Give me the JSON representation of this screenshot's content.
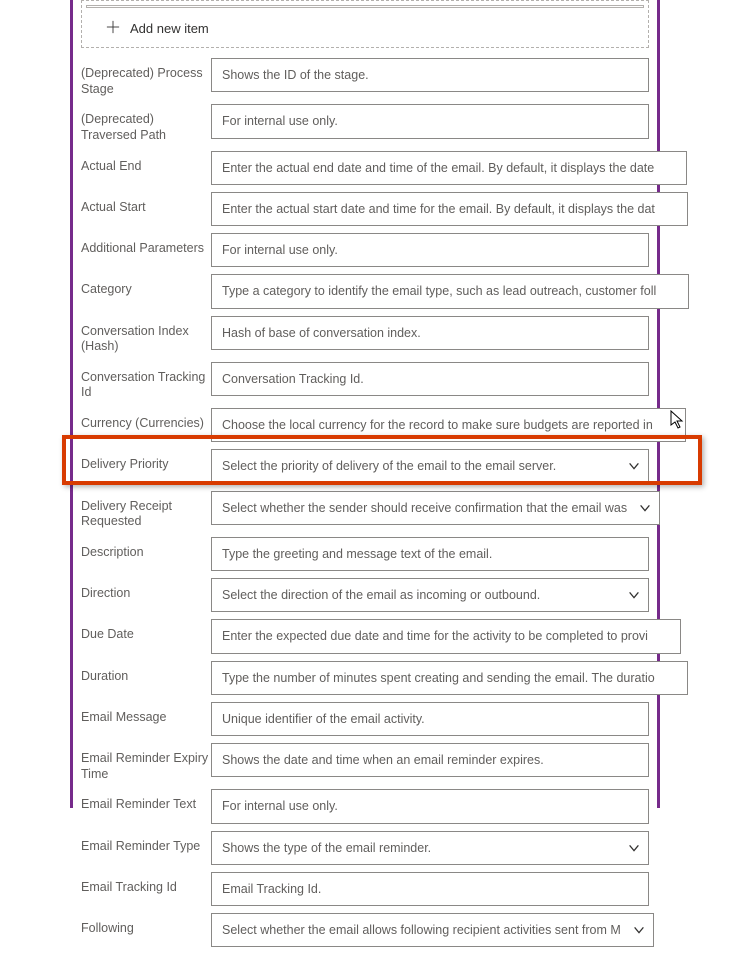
{
  "add_new_item": "Add new item",
  "fields": [
    {
      "label": "(Deprecated) Process Stage",
      "value": "Shows the ID of the stage.",
      "dropdown": false
    },
    {
      "label": "(Deprecated) Traversed Path",
      "value": "For internal use only.",
      "dropdown": false
    },
    {
      "label": "Actual End",
      "value": "Enter the actual end date and time of the email. By default, it displays the date",
      "dropdown": false
    },
    {
      "label": "Actual Start",
      "value": "Enter the actual start date and time for the email. By default, it displays the dat",
      "dropdown": false
    },
    {
      "label": "Additional Parameters",
      "value": "For internal use only.",
      "dropdown": false
    },
    {
      "label": "Category",
      "value": "Type a category to identify the email type, such as lead outreach, customer foll",
      "dropdown": false
    },
    {
      "label": "Conversation Index (Hash)",
      "value": "Hash of base of conversation index.",
      "dropdown": false
    },
    {
      "label": "Conversation Tracking Id",
      "value": "Conversation Tracking Id.",
      "dropdown": false
    },
    {
      "label": "Currency (Currencies)",
      "value": "Choose the local currency for the record to make sure budgets are reported in",
      "dropdown": false
    },
    {
      "label": "Delivery Priority",
      "value": "Select the priority of delivery of the email to the email server.",
      "dropdown": true
    },
    {
      "label": "Delivery Receipt Requested",
      "value": "Select whether the sender should receive confirmation that the email was",
      "dropdown": true
    },
    {
      "label": "Description",
      "value": "Type the greeting and message text of the email.",
      "dropdown": false
    },
    {
      "label": "Direction",
      "value": "Select the direction of the email as incoming or outbound.",
      "dropdown": true
    },
    {
      "label": "Due Date",
      "value": "Enter the expected due date and time for the activity to be completed to provi",
      "dropdown": false
    },
    {
      "label": "Duration",
      "value": "Type the number of minutes spent creating and sending the email. The duratio",
      "dropdown": false
    },
    {
      "label": "Email Message",
      "value": "Unique identifier of the email activity.",
      "dropdown": false
    },
    {
      "label": "Email Reminder Expiry Time",
      "value": "Shows the date and time when an email reminder expires.",
      "dropdown": false
    },
    {
      "label": "Email Reminder Text",
      "value": "For internal use only.",
      "dropdown": false
    },
    {
      "label": "Email Reminder Type",
      "value": "Shows the type of the email reminder.",
      "dropdown": true
    },
    {
      "label": "Email Tracking Id",
      "value": "Email Tracking Id.",
      "dropdown": false
    },
    {
      "label": "Following",
      "value": "Select whether the email allows following recipient activities sent from M",
      "dropdown": true
    }
  ]
}
